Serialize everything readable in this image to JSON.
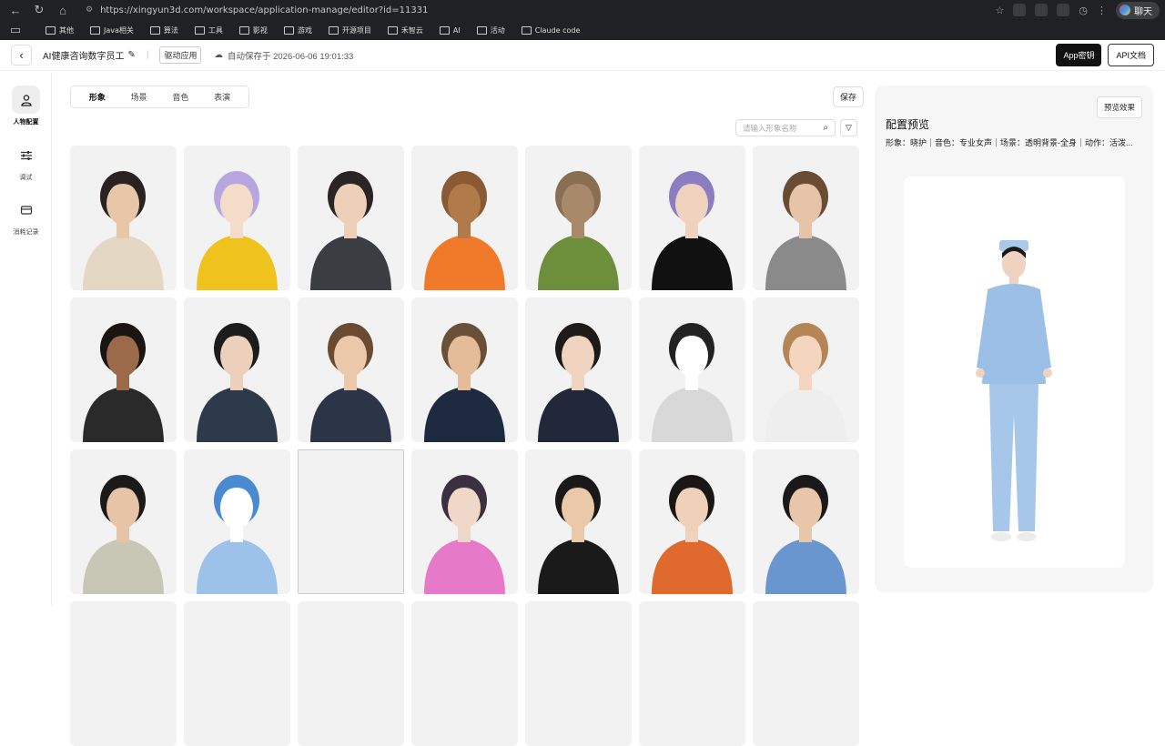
{
  "browser": {
    "url": "https://xingyun3d.com/workspace/application-manage/editor?id=11331",
    "chat_label": "聊天",
    "bookmarks": [
      "其他",
      "Java相关",
      "算法",
      "工具",
      "影视",
      "游戏",
      "开源项目",
      "禾智云",
      "AI",
      "活动",
      "Claude code"
    ]
  },
  "header": {
    "back_icon": "arrow-left-icon",
    "app_title": "AI健康咨询数字员工",
    "tag": "驱动应用",
    "autosave": "自动保存于 2026-06-06 19:01:33",
    "app_key_label": "App密钥",
    "api_doc_label": "API文档"
  },
  "sidebar": {
    "items": [
      {
        "label": "人物配置",
        "icon": "person-icon"
      },
      {
        "label": "调试",
        "icon": "sliders-icon"
      },
      {
        "label": "消耗记录",
        "icon": "card-icon"
      }
    ]
  },
  "tabs": [
    "形象",
    "场景",
    "音色",
    "表演"
  ],
  "save_label": "保存",
  "search": {
    "placeholder": "请输入形象名称"
  },
  "preview": {
    "button": "预览效果",
    "title": "配置预览",
    "info": "形象：晓护｜音色：专业女声｜场景：透明背景-全身｜动作：活泼..."
  },
  "colors": {
    "accent": "#111111",
    "card_bg": "#f2f2f2",
    "preview_bg": "#f6f6f6"
  },
  "avatars": [
    {
      "skin": "#e8c6a8",
      "hair": "#2a2220",
      "cloth": "#e4d8c4"
    },
    {
      "skin": "#f4dcc9",
      "hair": "#b8a6e0",
      "cloth": "#f0c21e"
    },
    {
      "skin": "#ecd0b8",
      "hair": "#2b2424",
      "cloth": "#3a3d42"
    },
    {
      "skin": "#b07a4a",
      "hair": "#8a5a34",
      "cloth": "#f07a2a"
    },
    {
      "skin": "#a88a6a",
      "hair": "#8a6e52",
      "cloth": "#6d8f3c"
    },
    {
      "skin": "#f0d2bf",
      "hair": "#8a7ec0",
      "cloth": "#111111"
    },
    {
      "skin": "#e6c4a8",
      "hair": "#6a4c34",
      "cloth": "#8a8a8a"
    },
    {
      "skin": "#9a6a4a",
      "hair": "#1a1412",
      "cloth": "#2a2a2a"
    },
    {
      "skin": "#ecd0bc",
      "hair": "#1c1c1c",
      "cloth": "#2c3a4a"
    },
    {
      "skin": "#ecc8aa",
      "hair": "#6a4a30",
      "cloth": "#2c3448"
    },
    {
      "skin": "#e4bc9a",
      "hair": "#6a5038",
      "cloth": "#1e2a40"
    },
    {
      "skin": "#f0d4c0",
      "hair": "#1e1a18",
      "cloth": "#22283a"
    },
    {
      "skin": "#ffffff",
      "hair": "#222222",
      "cloth": "#d8d8d8"
    },
    {
      "skin": "#f4d6c0",
      "hair": "#b48656",
      "cloth": "#eeeeee"
    },
    {
      "skin": "#e8c4a6",
      "hair": "#1c1a18",
      "cloth": "#c8c6b4"
    },
    {
      "skin": "#ffffff",
      "hair": "#4a8ad0",
      "cloth": "#9cc2ea"
    },
    {
      "broken": true
    },
    {
      "skin": "#f0d8c8",
      "hair": "#3a3040",
      "cloth": "#e67ac8"
    },
    {
      "skin": "#ecc8aa",
      "hair": "#1a1818",
      "cloth": "#1a1a1a"
    },
    {
      "skin": "#f0d0b8",
      "hair": "#1a1614",
      "cloth": "#e06a2e"
    },
    {
      "skin": "#e8c6aa",
      "hair": "#1a1818",
      "cloth": "#6a96d0"
    }
  ]
}
